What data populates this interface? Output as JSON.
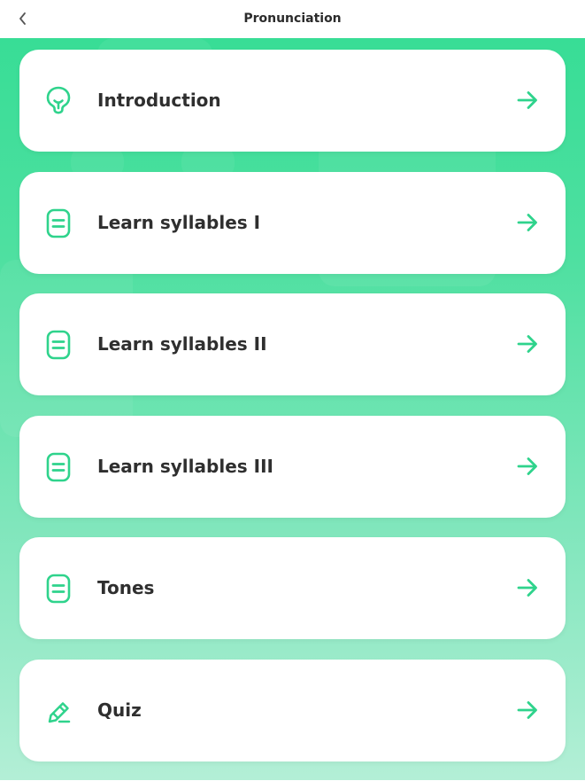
{
  "header": {
    "title": "Pronunciation",
    "back_icon": "chevron-left-icon"
  },
  "colors": {
    "accent": "#2fd38c",
    "background_top": "#38dd96",
    "background_bottom": "#b3efd6",
    "card": "#ffffff",
    "text": "#2f2f2f"
  },
  "lessons": [
    {
      "label": "Introduction",
      "icon": "lightbulb-icon"
    },
    {
      "label": "Learn syllables I",
      "icon": "document-icon"
    },
    {
      "label": "Learn syllables II",
      "icon": "document-icon"
    },
    {
      "label": "Learn syllables III",
      "icon": "document-icon"
    },
    {
      "label": "Tones",
      "icon": "document-icon"
    },
    {
      "label": "Quiz",
      "icon": "pencil-icon"
    }
  ]
}
